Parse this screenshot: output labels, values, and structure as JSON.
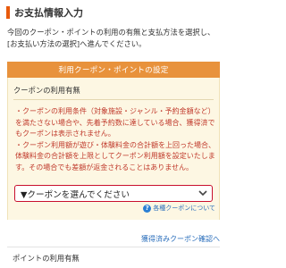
{
  "payment_section": {
    "title": "お支払情報入力",
    "intro_lines": [
      "今回のクーポン・ポイントの利用の有無と支払方法を選択し、",
      "[お支払い方法の選択]へ進んでください。"
    ]
  },
  "coupon_settings": {
    "header": "利用クーポン・ポイントの設定",
    "coupon_usage_heading": "クーポンの利用有無",
    "notes": [
      "・クーポンの利用条件（対象施設・ジャンル・予約金額など）を満たさない場合や、先着予約数に達している場合、獲得済でもクーポンは表示されません。",
      "・クーポン利用額が遊び・体験料金の合計額を上回った場合、体験料金の合計額を上限としてクーポン利用額を設定いたします。その場合でも差額が返金されることはありません。"
    ],
    "coupon_select": {
      "selected": "▼クーポンを選んでください"
    },
    "coupon_info_link": "各種クーポンについて"
  },
  "acquired_coupons_link": "獲得済みクーポン確認へ",
  "points_usage_heading": "ポイントの利用有無",
  "colors": {
    "accent_orange": "#e8923c",
    "title_bar": "#e85a0c",
    "note_red": "#c0392b",
    "select_border": "#c8102e",
    "link_blue": "#2a6ebb",
    "box_background": "#fdf7e3"
  },
  "icons": {
    "chevron": "chevron-down-icon",
    "info": "question-circle-icon"
  }
}
